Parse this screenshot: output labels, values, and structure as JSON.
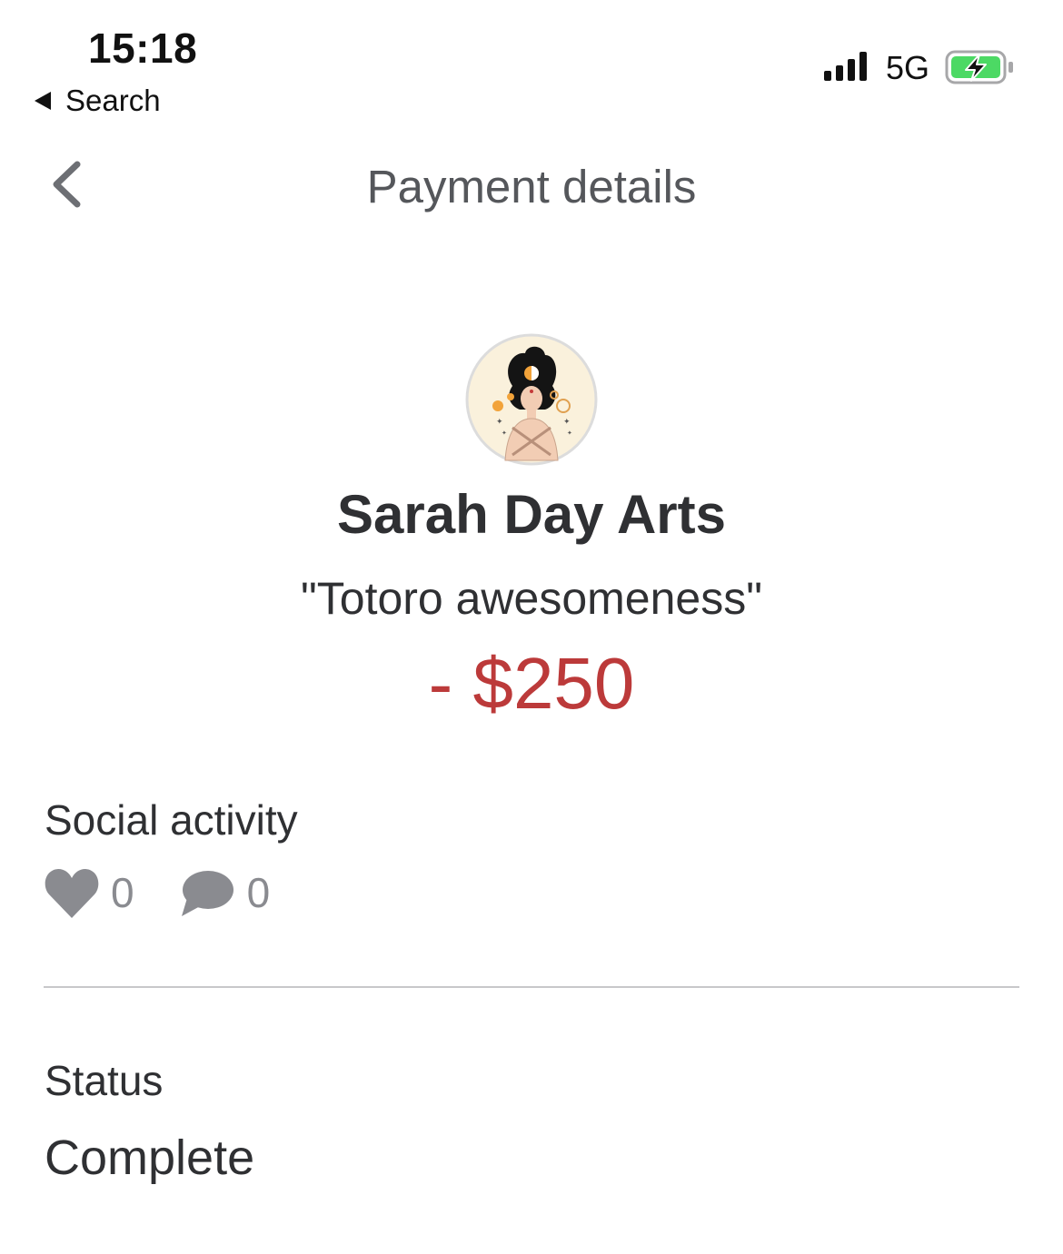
{
  "status_bar": {
    "time": "15:18",
    "back_app": "Search",
    "network": "5G",
    "icons": [
      "signal-bars-icon",
      "battery-charging-icon"
    ]
  },
  "header": {
    "title": "Payment details",
    "back_icon": "chevron-left-icon"
  },
  "payment": {
    "merchant": "Sarah Day Arts",
    "note": "\"Totoro awesomeness\"",
    "amount": "- $250"
  },
  "social": {
    "title": "Social activity",
    "likes": "0",
    "comments": "0",
    "icons": [
      "heart-icon",
      "comment-icon"
    ]
  },
  "status": {
    "label": "Status",
    "value": "Complete"
  },
  "colors": {
    "amount": "#bc3a3a",
    "text": "#2f3033",
    "muted": "#8a8b90",
    "battery_fill": "#4cd964"
  }
}
